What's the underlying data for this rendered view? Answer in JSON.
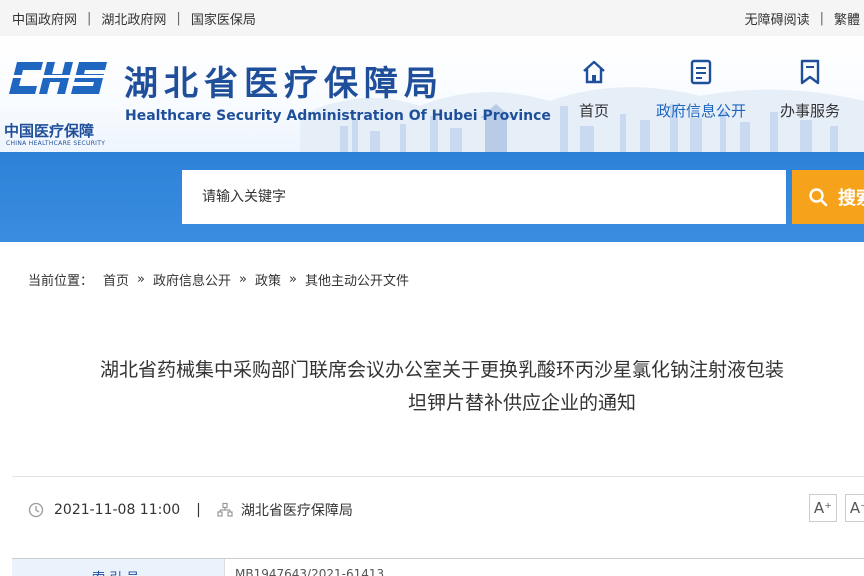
{
  "topbar": {
    "links": [
      "中国政府网",
      "湖北政府网",
      "国家医保局"
    ],
    "accessible": "无障碍阅读",
    "traditional": "繁體"
  },
  "header": {
    "logo_mark": "CHS",
    "logo_cn": "中国医疗保障",
    "logo_en": "CHINA HEALTHCARE SECURITY",
    "title": "湖北省医疗保障局",
    "subtitle": "Healthcare Security Administration Of Hubei Province",
    "nav": [
      {
        "label": "首页",
        "icon": "home-icon",
        "active": false
      },
      {
        "label": "政府信息公开",
        "icon": "document-icon",
        "active": true
      },
      {
        "label": "办事服务",
        "icon": "bookmark-icon",
        "active": false
      }
    ]
  },
  "search": {
    "placeholder": "请输入关键字",
    "button_label": "搜索"
  },
  "breadcrumb": {
    "prefix": "当前位置：",
    "items": [
      "首页",
      "政府信息公开",
      "政策",
      "其他主动公开文件"
    ],
    "separator": "»"
  },
  "article": {
    "title_line1": "湖北省药械集中采购部门联席会议办公室关于更换乳酸环丙沙星氯化钠注射液包装",
    "title_line2": "坦钾片替补供应企业的通知",
    "date": "2021-11-08 11:00",
    "source": "湖北省医疗保障局",
    "font_up": "A⁺",
    "font_down": "A⁻"
  },
  "info_table": {
    "label": "索 引 号",
    "value": "MB1947643/2021-61413"
  },
  "colors": {
    "brand_blue": "#1f4f9a",
    "band_blue": "#3a8de0",
    "search_orange": "#f7a21b",
    "nav_active": "#1f66c1"
  }
}
